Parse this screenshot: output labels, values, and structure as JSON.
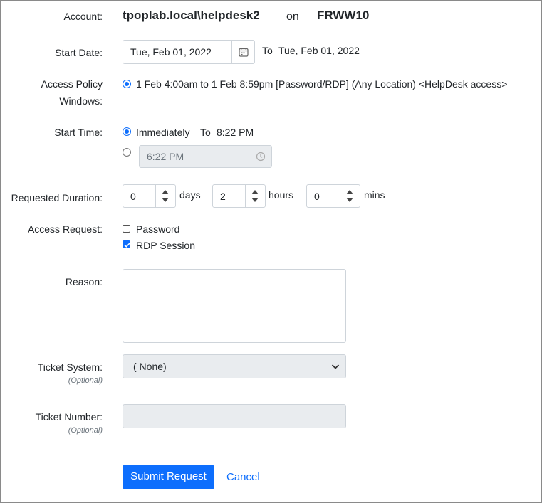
{
  "account": {
    "label": "Account:",
    "name": "tpoplab.local\\helpdesk2",
    "on_word": "on",
    "host": "FRWW10"
  },
  "start_date": {
    "label": "Start Date:",
    "value": "Tue, Feb 01, 2022",
    "to_word": "To",
    "to_value": "Tue, Feb 01, 2022",
    "icon": "calendar-icon"
  },
  "policy": {
    "label_line1": "Access Policy",
    "label_line2": "Windows:",
    "option": "1 Feb 4:00am to 1 Feb 8:59pm [Password/RDP] (Any Location) <HelpDesk access>",
    "selected": true
  },
  "start_time": {
    "label": "Start Time:",
    "immediately_label": "Immediately",
    "to_word": "To",
    "to_time": "8:22 PM",
    "custom_value": "6:22 PM",
    "mode": "immediately",
    "icon": "clock-icon"
  },
  "duration": {
    "label": "Requested Duration:",
    "days_value": "0",
    "days_label": "days",
    "hours_value": "2",
    "hours_label": "hours",
    "mins_value": "0",
    "mins_label": "mins"
  },
  "access_request": {
    "label": "Access Request:",
    "options": [
      {
        "label": "Password",
        "checked": false
      },
      {
        "label": "RDP Session",
        "checked": true
      }
    ]
  },
  "reason": {
    "label": "Reason:",
    "value": ""
  },
  "ticket_system": {
    "label": "Ticket System:",
    "optional": "(Optional)",
    "selected": "( None)"
  },
  "ticket_number": {
    "label": "Ticket Number:",
    "optional": "(Optional)",
    "value": ""
  },
  "actions": {
    "submit": "Submit Request",
    "cancel": "Cancel"
  },
  "colors": {
    "primary": "#0d6efd",
    "disabled_bg": "#e9ecef",
    "border": "#ced4da"
  }
}
